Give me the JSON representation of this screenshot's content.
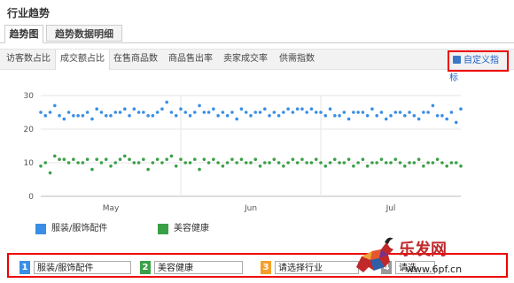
{
  "page": {
    "title": "行业趋势"
  },
  "main_tabs": [
    {
      "label": "趋势图"
    },
    {
      "label": "趋势数据明细"
    }
  ],
  "sub_tabs": [
    {
      "label": "访客数占比"
    },
    {
      "label": "成交额占比"
    },
    {
      "label": "在售商品数"
    },
    {
      "label": "商品售出率"
    },
    {
      "label": "卖家成交率"
    },
    {
      "label": "供需指数"
    }
  ],
  "custom_metric": {
    "label": "自定义指标"
  },
  "colors": {
    "blue": "#3a8ee6",
    "green": "#3aa047",
    "accent_red": "#e00000"
  },
  "chart_data": {
    "type": "line",
    "y_ticks": [
      "0",
      "10",
      "20",
      "30"
    ],
    "ylim": [
      0,
      30
    ],
    "x_tick_labels": [
      "May",
      "Jun",
      "Jul"
    ],
    "x_tick_label_positions": [
      15,
      45,
      75
    ],
    "x_range": [
      0,
      90
    ],
    "series": [
      {
        "name": "服装/服饰配件",
        "color": "#3a8ee6",
        "values": [
          25,
          24,
          25,
          27,
          24,
          23,
          25,
          24,
          24,
          24,
          25,
          23,
          26,
          25,
          24,
          24,
          25,
          25,
          26,
          24,
          26,
          25,
          25,
          24,
          24,
          25,
          26,
          28,
          25,
          24,
          26,
          25,
          24,
          25,
          27,
          25,
          25,
          26,
          24,
          25,
          24,
          25,
          23,
          26,
          25,
          24,
          25,
          25,
          26,
          24,
          25,
          24,
          25,
          26,
          25,
          26,
          26,
          25,
          26,
          25,
          25,
          24,
          26,
          24,
          24,
          25,
          23,
          25,
          25,
          25,
          24,
          26,
          24,
          25,
          23,
          24,
          25,
          25,
          24,
          25,
          24,
          23,
          25,
          25,
          27,
          24,
          24,
          23,
          25,
          22,
          26
        ]
      },
      {
        "name": "美容健康",
        "color": "#3aa047",
        "values": [
          9,
          10,
          7,
          12,
          11,
          11,
          10,
          11,
          10,
          10,
          11,
          8,
          11,
          10,
          11,
          9,
          10,
          11,
          12,
          11,
          10,
          10,
          11,
          8,
          10,
          11,
          10,
          11,
          12,
          9,
          11,
          10,
          10,
          11,
          8,
          11,
          10,
          11,
          10,
          9,
          10,
          11,
          10,
          11,
          10,
          10,
          11,
          9,
          10,
          10,
          11,
          10,
          9,
          10,
          11,
          10,
          11,
          10,
          10,
          11,
          10,
          9,
          10,
          11,
          10,
          10,
          11,
          9,
          10,
          11,
          9,
          10,
          10,
          11,
          10,
          10,
          11,
          10,
          9,
          10,
          10,
          11,
          9,
          10,
          10,
          11,
          10,
          9,
          10,
          10,
          9
        ]
      }
    ]
  },
  "legend": [
    {
      "label": "服装/服饰配件"
    },
    {
      "label": "美容健康"
    }
  ],
  "selectors": [
    {
      "num": "1",
      "value": "服装/服饰配件",
      "color": "#3a8ee6"
    },
    {
      "num": "2",
      "value": "美容健康",
      "color": "#3aa047"
    },
    {
      "num": "3",
      "value": "请选择行业",
      "color": "#f5a02a"
    },
    {
      "num": "4",
      "value": "请选",
      "color": "#999999"
    }
  ],
  "watermark": {
    "brand": "乐发网",
    "url": "www.6pf.cn"
  }
}
